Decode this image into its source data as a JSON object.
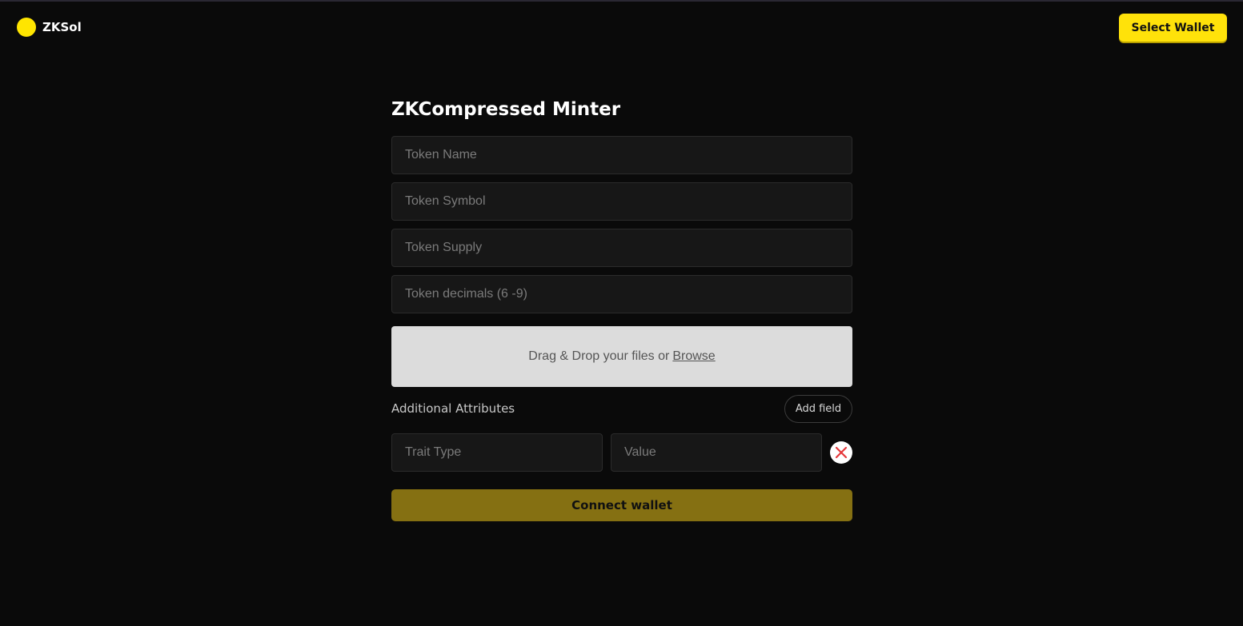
{
  "brand": {
    "name": "ZKSol",
    "logo_color": "#ffe500"
  },
  "header": {
    "select_wallet_label": "Select Wallet"
  },
  "form": {
    "title": "ZKCompressed Minter",
    "token_name_placeholder": "Token Name",
    "token_symbol_placeholder": "Token Symbol",
    "token_supply_placeholder": "Token Supply",
    "token_decimals_placeholder": "Token decimals (6 -9)",
    "dropzone": {
      "text": "Drag & Drop your files or",
      "browse_label": "Browse"
    },
    "attributes": {
      "label": "Additional Attributes",
      "add_field_label": "Add field",
      "rows": [
        {
          "trait_type_placeholder": "Trait Type",
          "value_placeholder": "Value",
          "remove_icon": "close-circle-icon"
        }
      ]
    },
    "connect_label": "Connect wallet"
  },
  "colors": {
    "background": "#0a0a0a",
    "accent": "#ffe20a",
    "connect_button": "#857012",
    "remove_icon": "#e5383b"
  }
}
